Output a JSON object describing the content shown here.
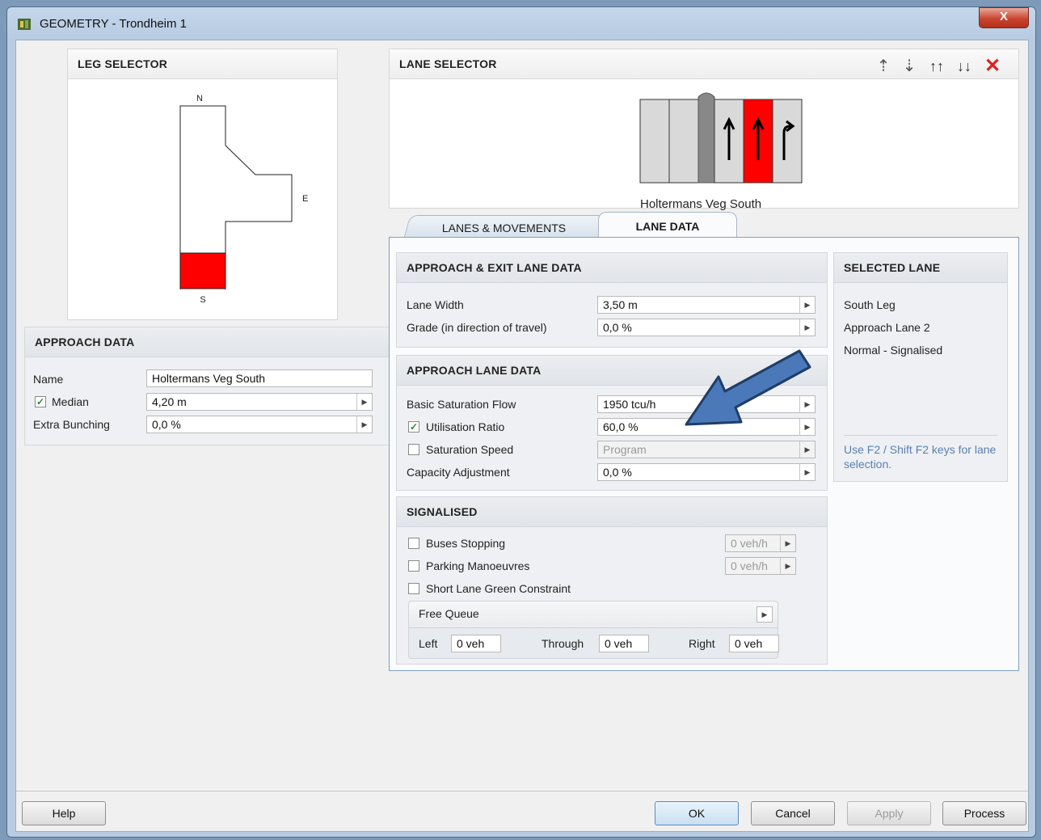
{
  "window": {
    "title": "GEOMETRY - Trondheim 1",
    "close_glyph": "X"
  },
  "leg_selector": {
    "header": "LEG SELECTOR",
    "compass": {
      "n": "N",
      "e": "E",
      "s": "S"
    },
    "selected_leg_color": "#ff0000"
  },
  "approach_data": {
    "header": "APPROACH DATA",
    "name_label": "Name",
    "name_value": "Holtermans Veg South",
    "median_label": "Median",
    "median_checked": true,
    "median_value": "4,20 m",
    "extra_bunching_label": "Extra Bunching",
    "extra_bunching_value": "0,0 %"
  },
  "lane_selector": {
    "header": "LANE SELECTOR",
    "toolbar": [
      "add-lane-left-icon",
      "add-lane-right-icon",
      "move-lanes-up-icon",
      "move-lanes-down-icon",
      "delete-lane-icon"
    ],
    "caption": "Holtermans Veg South",
    "selected_lane_color": "#ff0000"
  },
  "tabs": [
    {
      "label": "LANES & MOVEMENTS",
      "active": false
    },
    {
      "label": "LANE DATA",
      "active": true
    }
  ],
  "approach_exit_lane_data": {
    "header": "APPROACH & EXIT LANE DATA",
    "lane_width_label": "Lane Width",
    "lane_width_value": "3,50 m",
    "grade_label": "Grade (in direction of travel)",
    "grade_value": "0,0 %"
  },
  "approach_lane_data": {
    "header": "APPROACH LANE DATA",
    "basic_sat_flow_label": "Basic Saturation Flow",
    "basic_sat_flow_value": "1950 tcu/h",
    "utilisation_label": "Utilisation Ratio",
    "utilisation_checked": true,
    "utilisation_value": "60,0 %",
    "sat_speed_label": "Saturation Speed",
    "sat_speed_checked": false,
    "sat_speed_value": "Program",
    "capacity_adj_label": "Capacity Adjustment",
    "capacity_adj_value": "0,0 %"
  },
  "signalised": {
    "header": "SIGNALISED",
    "buses_label": "Buses Stopping",
    "buses_value": "0 veh/h",
    "parking_label": "Parking Manoeuvres",
    "parking_value": "0 veh/h",
    "short_lane_label": "Short Lane Green Constraint",
    "free_queue_label": "Free Queue",
    "left_label": "Left",
    "left_value": "0 veh",
    "through_label": "Through",
    "through_value": "0 veh",
    "right_label": "Right",
    "right_value": "0 veh"
  },
  "selected_lane": {
    "header": "SELECTED LANE",
    "line1": "South Leg",
    "line2": "Approach Lane 2",
    "line3": "Normal - Signalised",
    "hint": "Use F2 / Shift F2 keys for lane selection."
  },
  "buttons": {
    "help": "Help",
    "ok": "OK",
    "cancel": "Cancel",
    "apply": "Apply",
    "process": "Process"
  },
  "annotation_arrow_color": "#4a78b8"
}
